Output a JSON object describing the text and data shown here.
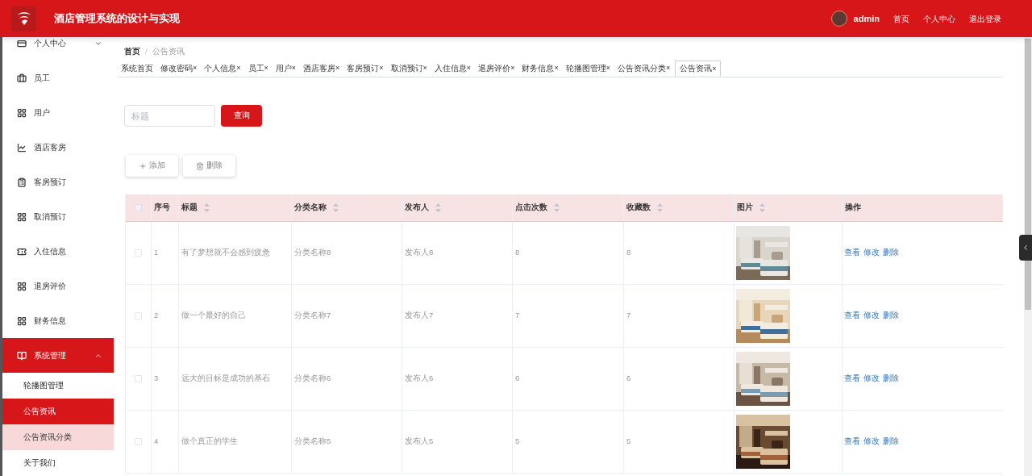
{
  "header": {
    "title": "酒店管理系统的设计与实现",
    "user": "admin",
    "links": [
      "首页",
      "个人中心",
      "退出登录"
    ]
  },
  "sidebar": {
    "items": [
      {
        "label": "个人中心",
        "expanded": false,
        "selected": false
      },
      {
        "label": "员工",
        "selected": false
      },
      {
        "label": "用户",
        "selected": false
      },
      {
        "label": "酒店客房",
        "selected": false
      },
      {
        "label": "客房预订",
        "selected": false
      },
      {
        "label": "取消预订",
        "selected": false
      },
      {
        "label": "入住信息",
        "selected": false
      },
      {
        "label": "退房评价",
        "selected": false
      },
      {
        "label": "财务信息",
        "selected": false
      },
      {
        "label": "系统管理",
        "expanded": true,
        "selected": true,
        "children": [
          {
            "label": "轮播图管理",
            "selected": false,
            "hovered": false
          },
          {
            "label": "公告资讯",
            "selected": true,
            "hovered": false
          },
          {
            "label": "公告资讯分类",
            "selected": false,
            "hovered": true
          },
          {
            "label": "关于我们",
            "selected": false,
            "hovered": false
          }
        ]
      }
    ]
  },
  "breadcrumb": [
    "首页",
    "公告资讯"
  ],
  "breadcrumb_separator": "/",
  "tabs": [
    {
      "label": "系统首页",
      "selected": false
    },
    {
      "label": "修改密码",
      "close": "×",
      "selected": false
    },
    {
      "label": "个人信息",
      "close": "×",
      "selected": false
    },
    {
      "label": "员工",
      "close": "×",
      "selected": false
    },
    {
      "label": "用户",
      "close": "×",
      "selected": false
    },
    {
      "label": "酒店客房",
      "close": "×",
      "selected": false
    },
    {
      "label": "客房预订",
      "close": "×",
      "selected": false
    },
    {
      "label": "取消预订",
      "close": "×",
      "selected": false
    },
    {
      "label": "入住信息",
      "close": "×",
      "selected": false
    },
    {
      "label": "退房评价",
      "close": "×",
      "selected": false
    },
    {
      "label": "财务信息",
      "close": "×",
      "selected": false
    },
    {
      "label": "轮播图管理",
      "close": "×",
      "selected": false
    },
    {
      "label": "公告资讯分类",
      "close": "×",
      "selected": false
    },
    {
      "label": "公告资讯",
      "close": "×",
      "selected": true
    }
  ],
  "search": {
    "placeholder": "标题",
    "button": "查询"
  },
  "actions": [
    {
      "label": "添加",
      "kind": "add"
    },
    {
      "label": "删除",
      "kind": "delete"
    }
  ],
  "table": {
    "columns": [
      {
        "label": "序号",
        "sortable": false
      },
      {
        "label": "标题",
        "sortable": true
      },
      {
        "label": "分类名称",
        "sortable": true
      },
      {
        "label": "发布人",
        "sortable": true
      },
      {
        "label": "点击次数",
        "sortable": true
      },
      {
        "label": "收藏数",
        "sortable": true
      },
      {
        "label": "图片",
        "sortable": true
      },
      {
        "label": "操作",
        "sortable": false
      }
    ],
    "all_checked": false,
    "rows": [
      {
        "checked": false,
        "index": "1",
        "title": "有了梦想就不会感到疲惫",
        "category": "分类名称8",
        "publisher": "发布人8",
        "clicks": "8",
        "favorites": "8",
        "picture": {
          "kind": "picture"
        },
        "operations": [
          "查看",
          "修改",
          "删除"
        ]
      },
      {
        "checked": false,
        "index": "2",
        "title": "做一个最好的自己",
        "category": "分类名称7",
        "publisher": "发布人7",
        "clicks": "7",
        "favorites": "7",
        "picture": {
          "kind": "picture"
        },
        "operations": [
          "查看",
          "修改",
          "删除"
        ]
      },
      {
        "checked": false,
        "index": "3",
        "title": "远大的目标是成功的基石",
        "category": "分类名称6",
        "publisher": "发布人6",
        "clicks": "6",
        "favorites": "6",
        "picture": {
          "kind": "picture"
        },
        "operations": [
          "查看",
          "修改",
          "删除"
        ]
      },
      {
        "checked": false,
        "index": "4",
        "title": "做个真正的学生",
        "category": "分类名称5",
        "publisher": "发布人5",
        "clicks": "5",
        "favorites": "5",
        "picture": {
          "kind": "picture"
        },
        "operations": [
          "查看",
          "修改",
          "删除"
        ]
      }
    ]
  }
}
